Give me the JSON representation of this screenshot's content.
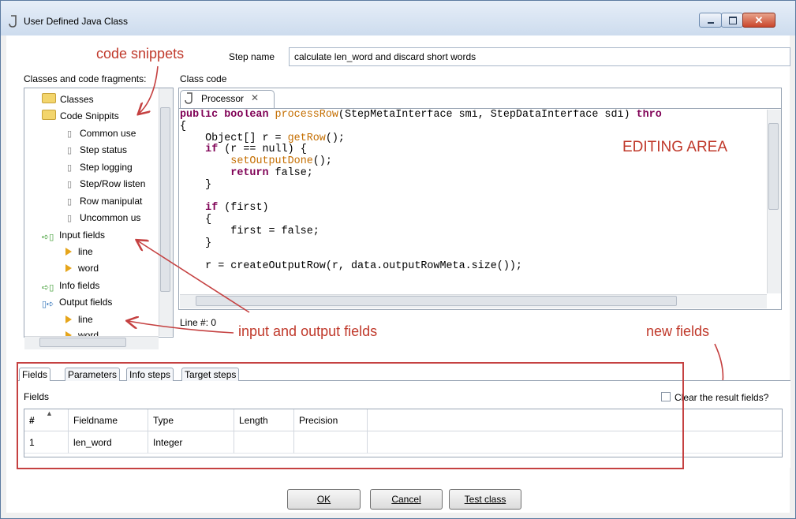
{
  "window": {
    "title": "User Defined Java Class"
  },
  "step": {
    "label": "Step name",
    "value": "calculate len_word and discard short words"
  },
  "left_panel": {
    "label": "Classes and code fragments:"
  },
  "tree": {
    "items": [
      {
        "label": "Classes",
        "icon": "folder-icon"
      },
      {
        "label": "Code Snippits",
        "icon": "folder-icon"
      },
      {
        "label": "Common use",
        "icon": "snippet-icon"
      },
      {
        "label": "Step status",
        "icon": "snippet-icon"
      },
      {
        "label": "Step logging",
        "icon": "snippet-icon"
      },
      {
        "label": "Step/Row listen",
        "icon": "snippet-icon"
      },
      {
        "label": "Row manipulat",
        "icon": "snippet-icon"
      },
      {
        "label": "Uncommon us",
        "icon": "snippet-icon"
      },
      {
        "label": "Input fields",
        "icon": "input-fields-icon"
      },
      {
        "label": "line",
        "icon": "field-arrow-icon"
      },
      {
        "label": "word",
        "icon": "field-arrow-icon"
      },
      {
        "label": "Info fields",
        "icon": "info-fields-icon"
      },
      {
        "label": "Output fields",
        "icon": "output-fields-icon"
      },
      {
        "label": "line",
        "icon": "field-arrow-icon"
      },
      {
        "label": "word",
        "icon": "field-arrow-icon"
      }
    ]
  },
  "code": {
    "label": "Class code",
    "tab": "Processor",
    "line_no": "Line #: 0"
  },
  "annotations": {
    "snippets": "code snippets",
    "editing": "EDITING AREA",
    "io": "input and output fields",
    "new": "new fields"
  },
  "bottom_tabs": [
    "Fields",
    "Parameters",
    "Info steps",
    "Target steps"
  ],
  "fields": {
    "label": "Fields",
    "clear_label": "Clear the result fields?",
    "columns": [
      "#",
      "Fieldname",
      "Type",
      "Length",
      "Precision"
    ],
    "rows": [
      [
        "1",
        "len_word",
        "Integer",
        "",
        ""
      ]
    ]
  },
  "buttons": {
    "ok": "OK",
    "cancel": "Cancel",
    "test": "Test class"
  },
  "colors": {
    "annotation": "#c0392b",
    "keyword": "#7f0055",
    "method": "#c46e00"
  }
}
